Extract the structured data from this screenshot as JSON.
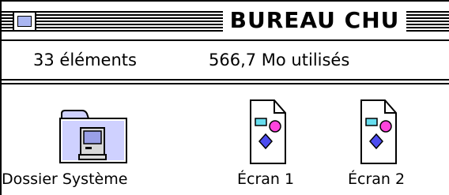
{
  "window": {
    "title": "BUREAU CHU",
    "status": {
      "count_label": "33 éléments",
      "used_label": "566,7 Mo utilisés"
    }
  },
  "icons": [
    {
      "label": "Dossier Système",
      "icon": "system-folder-icon"
    },
    {
      "label": "Écran 1",
      "icon": "picture-document-icon"
    },
    {
      "label": "Écran 2",
      "icon": "picture-document-icon"
    }
  ],
  "colors": {
    "folder": "#cfd1ff",
    "close_box": "#aab6f2",
    "doc_cyan": "#66ddee",
    "doc_pink": "#ff44dd",
    "doc_blue": "#4d4df0"
  }
}
